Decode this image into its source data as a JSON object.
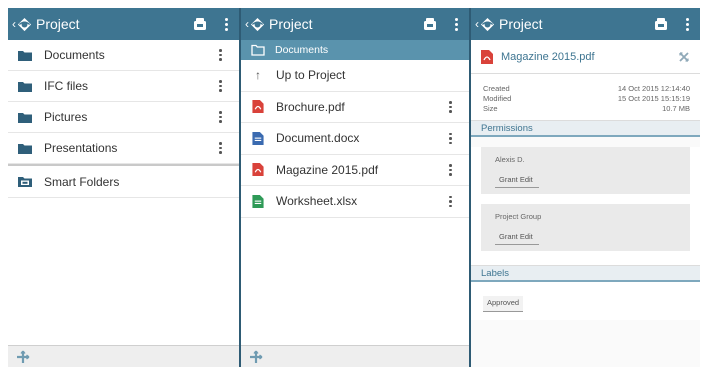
{
  "panels": [
    {
      "app_title": "Project",
      "items": [
        {
          "label": "Documents",
          "icon": "folder-icon"
        },
        {
          "label": "IFC files",
          "icon": "folder-icon"
        },
        {
          "label": "Pictures",
          "icon": "folder-icon"
        },
        {
          "label": "Presentations",
          "icon": "folder-icon"
        }
      ],
      "smart_folders": {
        "label": "Smart Folders",
        "icon": "smart-folder-icon"
      }
    },
    {
      "app_title": "Project",
      "current_folder": "Documents",
      "up_label": "Up to Project",
      "files": [
        {
          "label": "Brochure.pdf",
          "icon": "pdf-icon"
        },
        {
          "label": "Document.docx",
          "icon": "docx-icon"
        },
        {
          "label": "Magazine 2015.pdf",
          "icon": "pdf-icon"
        },
        {
          "label": "Worksheet.xlsx",
          "icon": "xlsx-icon"
        }
      ]
    },
    {
      "app_title": "Project",
      "file_name": "Magazine 2015.pdf",
      "meta": {
        "created_label": "Created",
        "created_value": "14 Oct 2015 12:14:40",
        "modified_label": "Modified",
        "modified_value": "15 Oct 2015 15:15:19",
        "size_label": "Size",
        "size_value": "10.7 MB"
      },
      "permissions_title": "Permissions",
      "permissions": [
        {
          "name": "Alexis D.",
          "action": "Grant Edit"
        },
        {
          "name": "Project Group",
          "action": "Grant Edit"
        }
      ],
      "labels_title": "Labels",
      "labels": [
        "Approved"
      ]
    }
  ],
  "colors": {
    "appbar": "#3e7591",
    "pdf": "#d9423a",
    "docx": "#3a6ab0",
    "xlsx": "#2e9a57",
    "folder": "#2f5f7a"
  }
}
